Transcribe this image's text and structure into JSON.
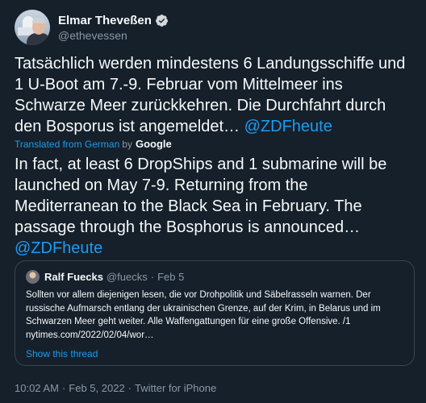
{
  "author": {
    "display_name": "Elmar Theveßen",
    "handle": "@ethevessen",
    "verified": true
  },
  "tweet": {
    "original_text": "Tatsächlich werden mindestens 6 Landungsschiffe und 1 U-Boot am 7.-9. Februar vom Mittelmeer ins Schwarze Meer zurückkehren. Die Durchfahrt durch den Bosporus ist angemeldet…",
    "original_mention": "@ZDFheute",
    "translated_label": "Translated from German",
    "translated_by": "by",
    "translator": "Google",
    "translation_text": "In fact, at least 6 DropShips and 1 submarine will be launched on May 7-9. Returning from the Mediterranean to the Black Sea in February. The passage through the Bosphorus is announced…",
    "translation_mention": "@ZDFheute"
  },
  "quote": {
    "display_name": "Ralf Fuecks",
    "handle": "@fuecks",
    "separator": "·",
    "date": "Feb 5",
    "text": "Sollten vor allem diejenigen lesen, die vor Drohpolitik und Säbelrasseln warnen. Der russische Aufmarsch entlang der ukrainischen Grenze, auf der Krim, in Belarus und im Schwarzen Meer geht weiter. Alle Waffengattungen für eine große Offensive. /1 nytimes.com/2022/02/04/wor…",
    "show_thread": "Show this thread"
  },
  "meta": {
    "time": "10:02 AM",
    "separator": "·",
    "date": "Feb 5, 2022",
    "source": "Twitter for iPhone"
  },
  "colors": {
    "background": "#15202b",
    "text": "#f7f9f9",
    "secondary": "#8b98a5",
    "accent": "#1d9bf0",
    "border": "#38444d"
  }
}
